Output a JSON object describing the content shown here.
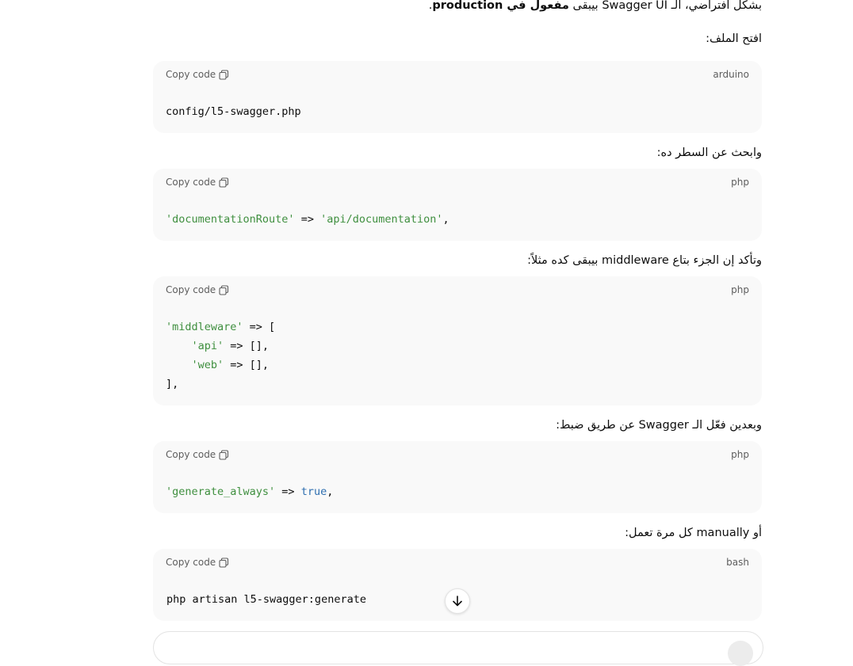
{
  "texts": {
    "p0_pre": "بشكل افتراضي، الـ Swagger UI بيبقى ",
    "p0_bold": "مفعول في production",
    "p0_post": ".",
    "p1": "افتح الملف:",
    "p2": "وابحث عن السطر ده:",
    "p3": "وتأكد إن الجزء بتاع middleware بيبقى كده مثلاً:",
    "p4": "وبعدين فعّل الـ Swagger عن طريق ضبط:",
    "p5": "أو manually كل مرة تعمل:"
  },
  "copy_label": "Copy code",
  "blocks": [
    {
      "lang": "arduino",
      "code": "config/l5-swagger.php"
    },
    {
      "lang": "php",
      "code": "'documentationRoute' => 'api/documentation',"
    },
    {
      "lang": "php",
      "code": "'middleware' => [\n    'api' => [],\n    'web' => [],\n],"
    },
    {
      "lang": "php",
      "code": "'generate_always' => true,"
    },
    {
      "lang": "bash",
      "code": "php artisan l5-swagger:generate"
    }
  ],
  "icons": {
    "copy": "copy-icon",
    "scroll": "arrow-down-icon"
  },
  "colors": {
    "string": "#3f8f3f",
    "keyword": "#2f6fb0",
    "block_bg": "#f9f9f9"
  }
}
